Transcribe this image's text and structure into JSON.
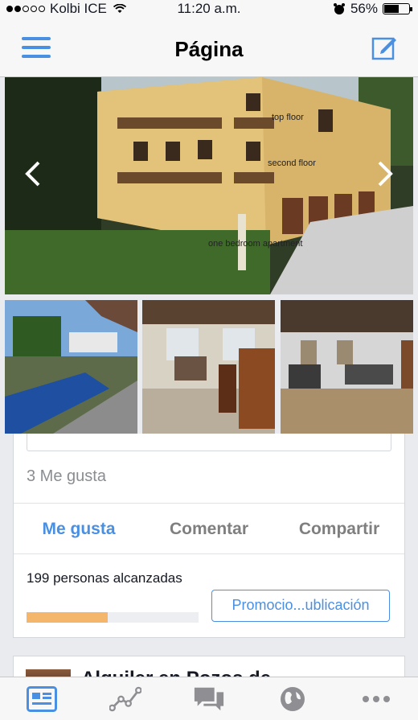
{
  "status_bar": {
    "carrier": "Kolbi ICE",
    "time": "11:20 a.m.",
    "battery": "56%"
  },
  "nav": {
    "title": "Página"
  },
  "photos": {
    "main_labels": {
      "top": "top floor",
      "second": "second floor",
      "bottom": "one bedroom apartment"
    }
  },
  "post": {
    "likes": "3 Me gusta",
    "actions": [
      "Me gusta",
      "Comentar",
      "Compartir"
    ],
    "reach_text": "199 personas alcanzadas",
    "reach_fraction": 0.47,
    "promote_label": "Promocio...ublicación"
  },
  "next_post": {
    "title": "Alquiler en Pozos de"
  },
  "tabs": [
    "news-feed-icon",
    "insights-icon",
    "messages-icon",
    "notifications-globe-icon",
    "more-icon"
  ],
  "colors": {
    "accent": "#4a90e2",
    "reach_fill": "#f4b66a"
  }
}
